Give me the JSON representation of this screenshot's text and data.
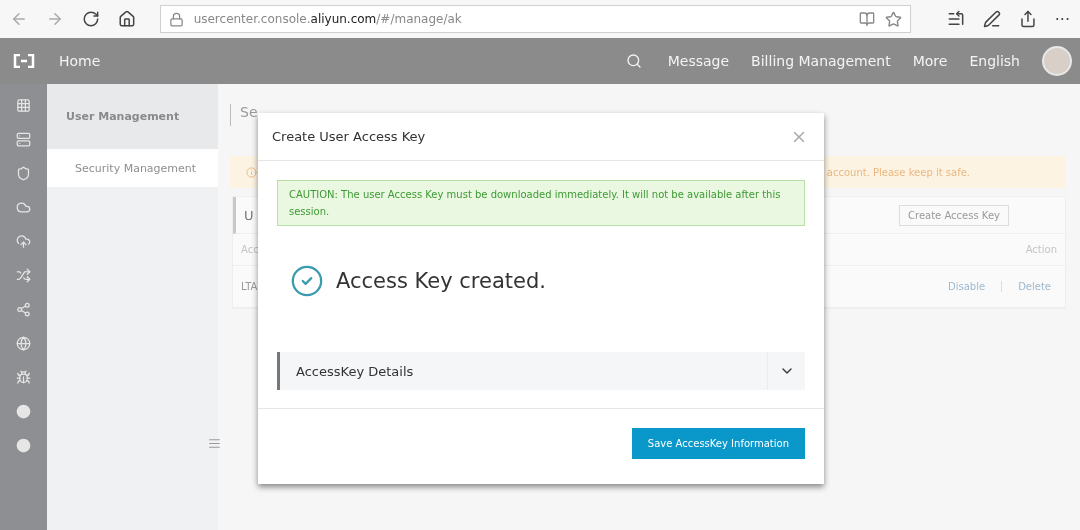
{
  "browser": {
    "url": "usercenter.console.**aliyun.com**/#/manage/ak",
    "more": "···"
  },
  "topnav": {
    "home": "Home",
    "links": [
      "Message",
      "Billing Management",
      "More",
      "English"
    ]
  },
  "sidebar": {
    "title": "User Management",
    "items": [
      {
        "label": "Security Management",
        "selected": true
      }
    ]
  },
  "content": {
    "heading": "Se",
    "warning": "account. Please keep it safe.",
    "table_title": "U",
    "create_button": "Create Access Key",
    "columns": [
      "Acc",
      "Action"
    ],
    "rows": [
      {
        "column_1": "LTA",
        "actions": [
          "Disable",
          "Delete"
        ]
      }
    ]
  },
  "dialog": {
    "title": "Create User Access Key",
    "caution": "CAUTION: The user Access Key must be downloaded immediately. It will not be available after this session.",
    "success": "Access Key created.",
    "details": {
      "label": "AccessKey Details",
      "expanded": false
    },
    "save_button": "Save AccessKey Information"
  }
}
